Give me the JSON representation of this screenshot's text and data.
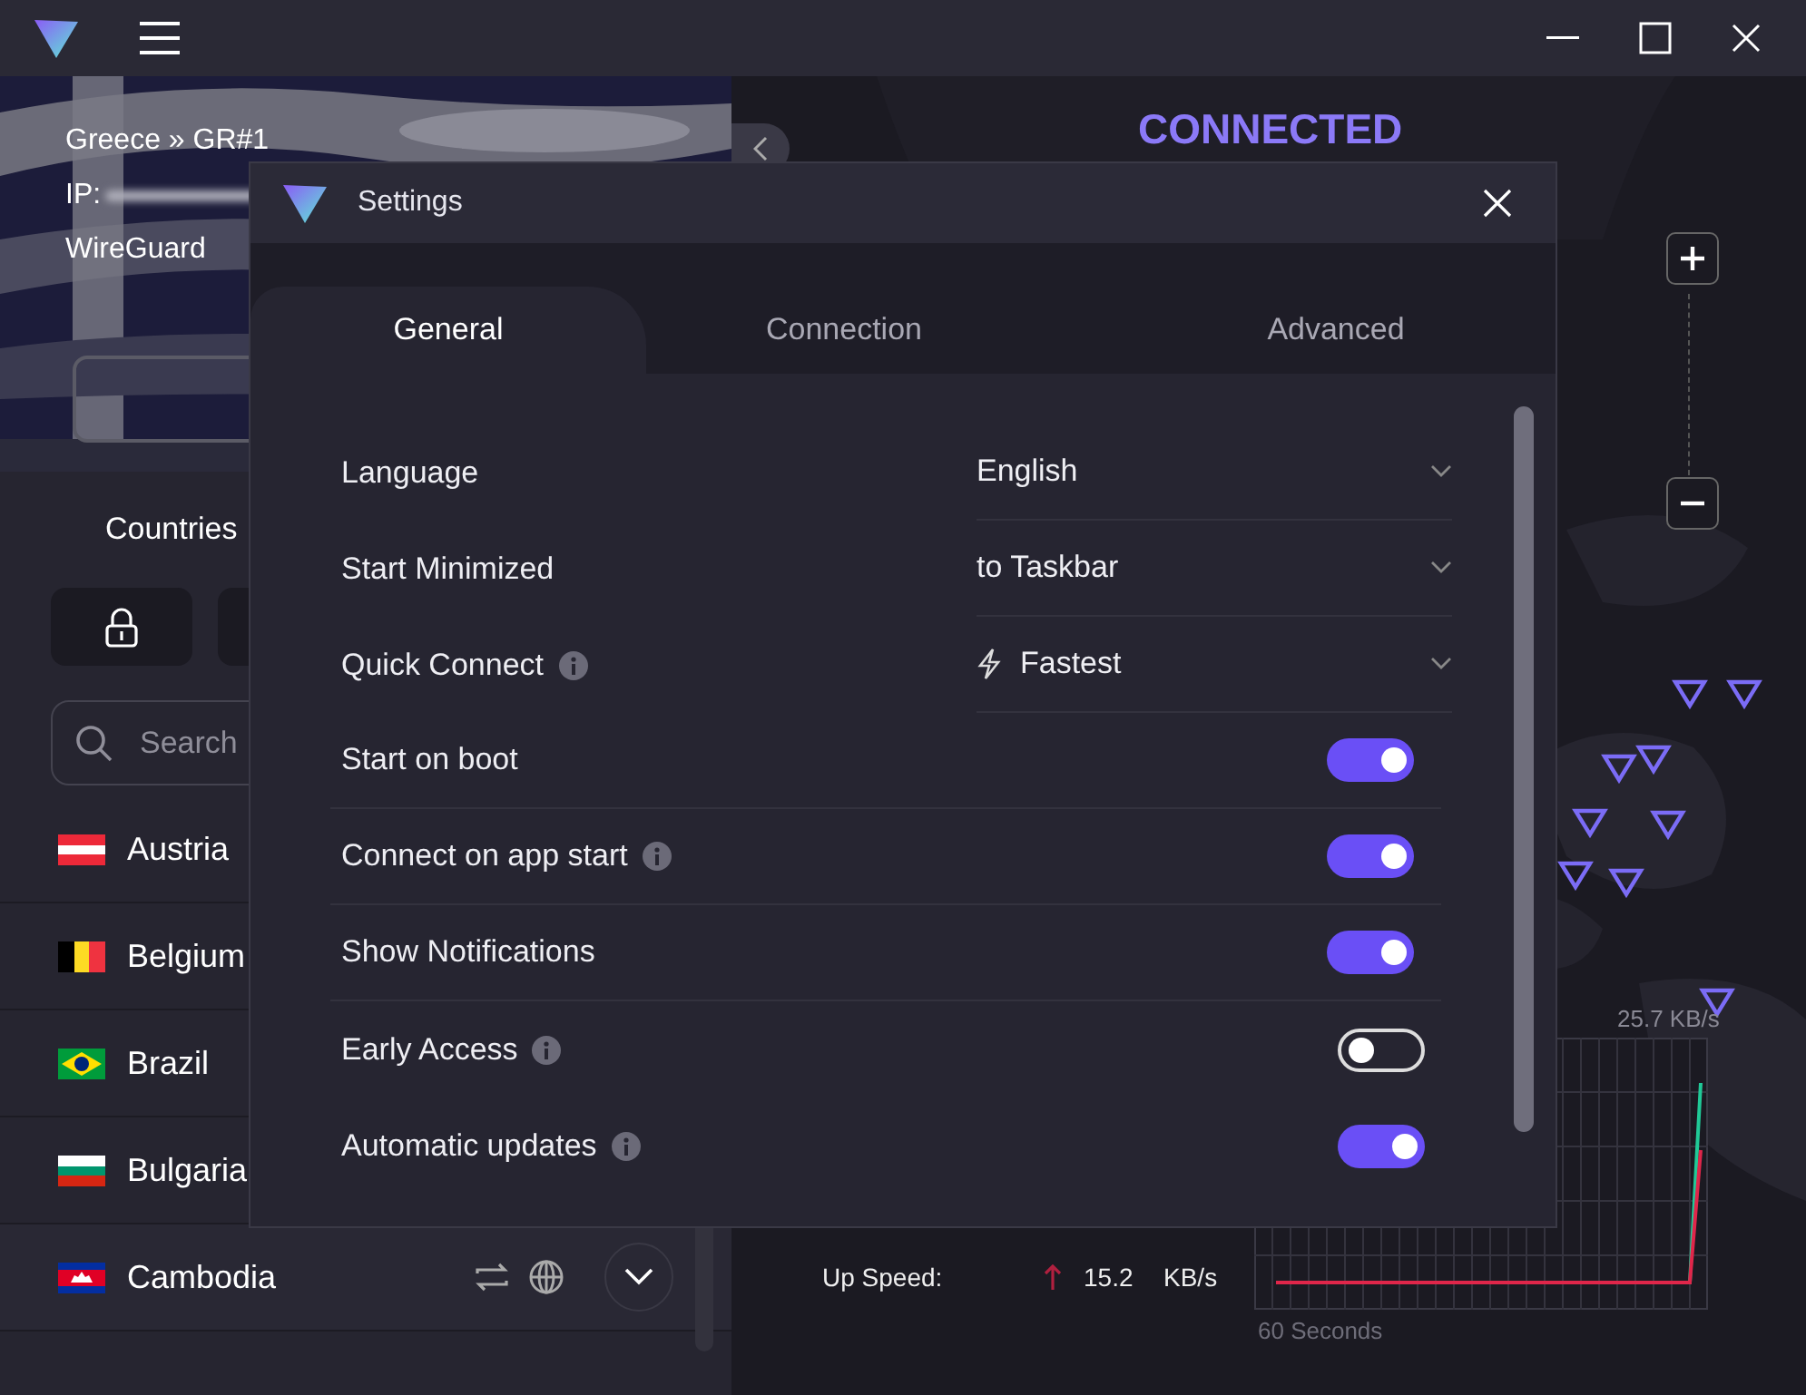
{
  "connection": {
    "location": "Greece » GR#1",
    "ip_label": "IP:",
    "protocol": "WireGuard"
  },
  "sidebar": {
    "tabs": [
      {
        "label": "Countries",
        "selected": true
      }
    ],
    "search": {
      "placeholder": "Search"
    },
    "countries": [
      {
        "name": "Austria"
      },
      {
        "name": "Belgium"
      },
      {
        "name": "Brazil"
      },
      {
        "name": "Bulgaria"
      },
      {
        "name": "Cambodia",
        "hovered": true
      }
    ]
  },
  "status": {
    "title": "CONNECTED"
  },
  "speeds": [
    {
      "label": "Up Speed:",
      "value": "15.2",
      "unit": "KB/s"
    }
  ],
  "speed_graph": {
    "max_label": "25.7 KB/s",
    "time_label": "60 Seconds"
  },
  "settings_dialog": {
    "title": "Settings",
    "tabs": [
      {
        "label": "General",
        "selected": true
      },
      {
        "label": "Connection",
        "selected": false
      },
      {
        "label": "Advanced",
        "selected": false
      }
    ],
    "rows": [
      {
        "kind": "select",
        "label": "Language",
        "value": "English",
        "info": false,
        "bolt": false
      },
      {
        "kind": "select",
        "label": "Start Minimized",
        "value": "to Taskbar",
        "info": false,
        "bolt": false
      },
      {
        "kind": "select",
        "label": "Quick Connect",
        "value": "Fastest",
        "info": true,
        "bolt": true
      },
      {
        "kind": "toggle",
        "label": "Start on boot",
        "on": true,
        "info": false
      },
      {
        "kind": "toggle",
        "label": "Connect on app start",
        "on": true,
        "info": true
      },
      {
        "kind": "toggle",
        "label": "Show Notifications",
        "on": true,
        "info": false
      },
      {
        "kind": "toggle",
        "label": "Early Access",
        "on": false,
        "info": true
      },
      {
        "kind": "toggle",
        "label": "Automatic updates",
        "on": true,
        "info": true
      }
    ]
  }
}
